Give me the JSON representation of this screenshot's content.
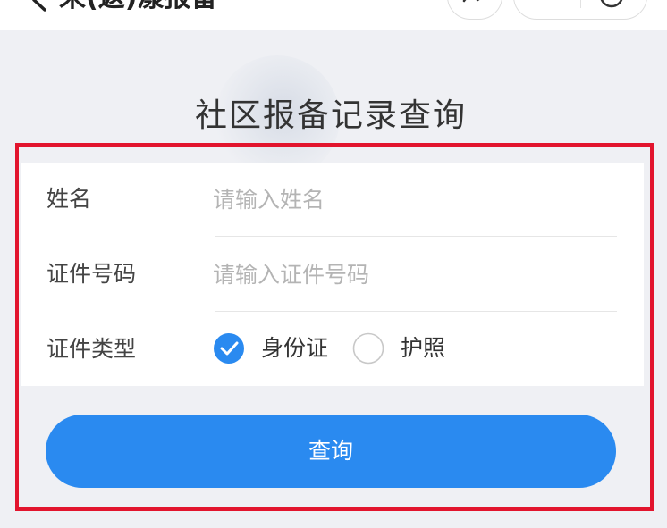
{
  "navbar": {
    "title": "来(返)漾报备",
    "icons": [
      "back-icon",
      "share-icon",
      "close-circle-icon"
    ]
  },
  "page": {
    "title": "社区报备记录查询"
  },
  "form": {
    "name": {
      "label": "姓名",
      "value": "",
      "placeholder": "请输入姓名"
    },
    "id_number": {
      "label": "证件号码",
      "value": "",
      "placeholder": "请输入证件号码"
    },
    "id_type": {
      "label": "证件类型",
      "options": [
        {
          "label": "身份证",
          "selected": true
        },
        {
          "label": "护照",
          "selected": false
        }
      ]
    }
  },
  "actions": {
    "query_label": "查询"
  },
  "colors": {
    "accent": "#2a8af0",
    "highlight": "#e2142d",
    "background": "#eff0f4"
  }
}
